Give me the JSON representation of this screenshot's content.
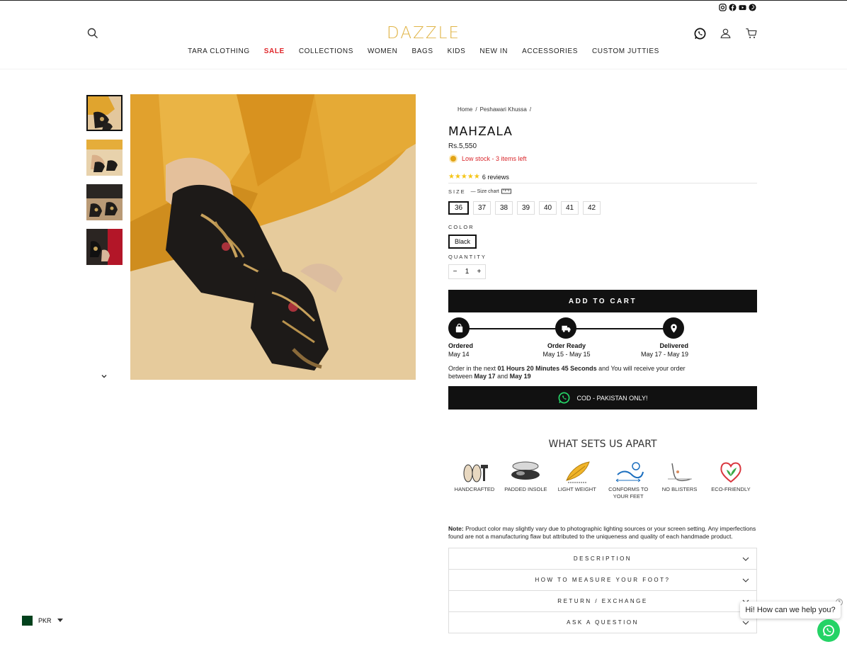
{
  "header": {
    "logo": "DAZZLE",
    "nav": [
      "TARA CLOTHING",
      "SALE",
      "COLLECTIONS",
      "WOMEN",
      "BAGS",
      "KIDS",
      "NEW IN",
      "ACCESSORIES",
      "CUSTOM JUTTIES"
    ],
    "social_icons": [
      "instagram-icon",
      "facebook-icon",
      "youtube-icon",
      "pinterest-icon"
    ],
    "utility_icons": [
      "whatsapp-icon",
      "account-icon",
      "cart-icon"
    ],
    "sale_color": "#e0262a",
    "logo_color": "#e0b447"
  },
  "product": {
    "breadcrumb": [
      "Home",
      "/",
      "Peshawari Khussa",
      "/"
    ],
    "title": "MAHZALA",
    "price": "Rs.5,550",
    "stock": "Low stock - 3 items left",
    "stars": "★★★★★",
    "reviews": "6 reviews",
    "size_label": "SIZE",
    "size_chart": "— Size chart",
    "sizes": [
      "36",
      "37",
      "38",
      "39",
      "40",
      "41",
      "42"
    ],
    "selected_size": "36",
    "color_label": "COLOR",
    "color": "Black",
    "quantity_label": "QUANTITY",
    "quantity": "1",
    "qty_minus": "−",
    "qty_plus": "+",
    "add_to_cart": "ADD TO CART"
  },
  "tracking": {
    "steps": [
      {
        "label": "Ordered",
        "date": "May 14"
      },
      {
        "label": "Order Ready",
        "date": "May 15 - May 15"
      },
      {
        "label": "Delivered",
        "date": "May 17 - May 19"
      }
    ],
    "eta_pre": "Order in the next ",
    "eta_time": "01 Hours 20 Minutes 45 Seconds",
    "eta_mid": " and You will receive your order between ",
    "eta_from": "May 17",
    "eta_and": " and ",
    "eta_to": "May 19"
  },
  "cod": "COD - PAKISTAN ONLY!",
  "apart": {
    "title": "WHAT SETS US APART",
    "features": [
      "HANDCRAFTED",
      "PADDED INSOLE",
      "LIGHT WEIGHT",
      "CONFORMS TO YOUR FEET",
      "NO BLISTERS",
      "ECO-FRIENDLY"
    ]
  },
  "note": {
    "label": "Note:",
    "text": " Product color may slightly vary due to photographic lighting sources or your screen setting. Any imperfections found are not a manufacturing flaw but attributed to the uniqueness and quality of each handmade product."
  },
  "accordion": [
    "DESCRIPTION",
    "HOW TO MEASURE YOUR FOOT?",
    "RETURN / EXCHANGE",
    "ASK A QUESTION"
  ],
  "currency": "PKR",
  "chat": {
    "greeting": "Hi! How can we help you?",
    "close": "×"
  }
}
